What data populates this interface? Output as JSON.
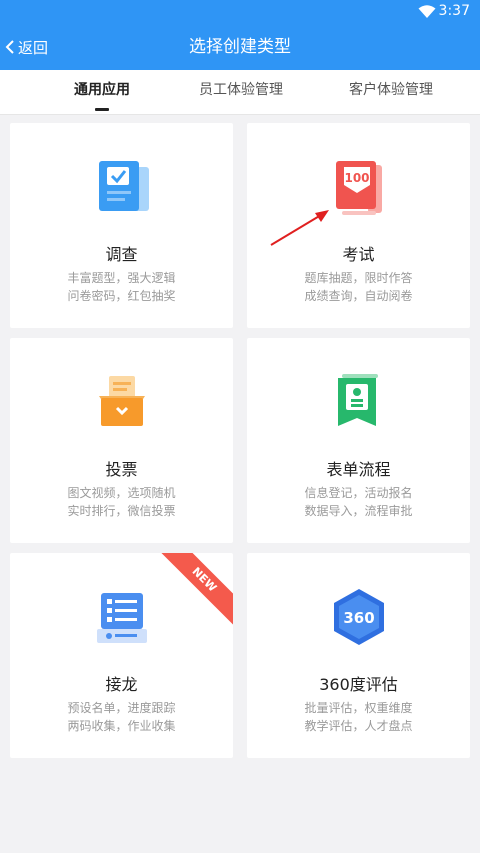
{
  "status_bar": {
    "time": "3:37",
    "wifi_icon": "wifi-icon"
  },
  "header": {
    "back_label": "返回",
    "title": "选择创建类型"
  },
  "tabs": [
    {
      "label": "通用应用",
      "active": true
    },
    {
      "label": "员工体验管理",
      "active": false
    },
    {
      "label": "客户体验管理",
      "active": false
    }
  ],
  "cards": [
    {
      "name": "调查",
      "desc": [
        "丰富题型，强大逻辑",
        "问卷密码，红包抽奖"
      ],
      "icon": "survey-icon",
      "color": "#3a9cf3"
    },
    {
      "name": "考试",
      "desc": [
        "题库抽题，限时作答",
        "成绩查询，自动阅卷"
      ],
      "icon": "exam-100-icon",
      "color": "#f0544f"
    },
    {
      "name": "投票",
      "desc": [
        "图文视频，选项随机",
        "实时排行，微信投票"
      ],
      "icon": "ballot-box-icon",
      "color": "#f79a2b"
    },
    {
      "name": "表单流程",
      "desc": [
        "信息登记，活动报名",
        "数据导入，流程审批"
      ],
      "icon": "form-badge-icon",
      "color": "#27b86c"
    },
    {
      "name": "接龙",
      "desc": [
        "预设名单，进度跟踪",
        "两码收集，作业收集"
      ],
      "icon": "relay-list-icon",
      "color": "#4a8ef0",
      "badge": "NEW"
    },
    {
      "name": "360度评估",
      "desc": [
        "批量评估，权重维度",
        "教学评估，人才盘点"
      ],
      "icon": "hexagon-360-icon",
      "color": "#2f6fe0",
      "icon_text": "360"
    }
  ]
}
